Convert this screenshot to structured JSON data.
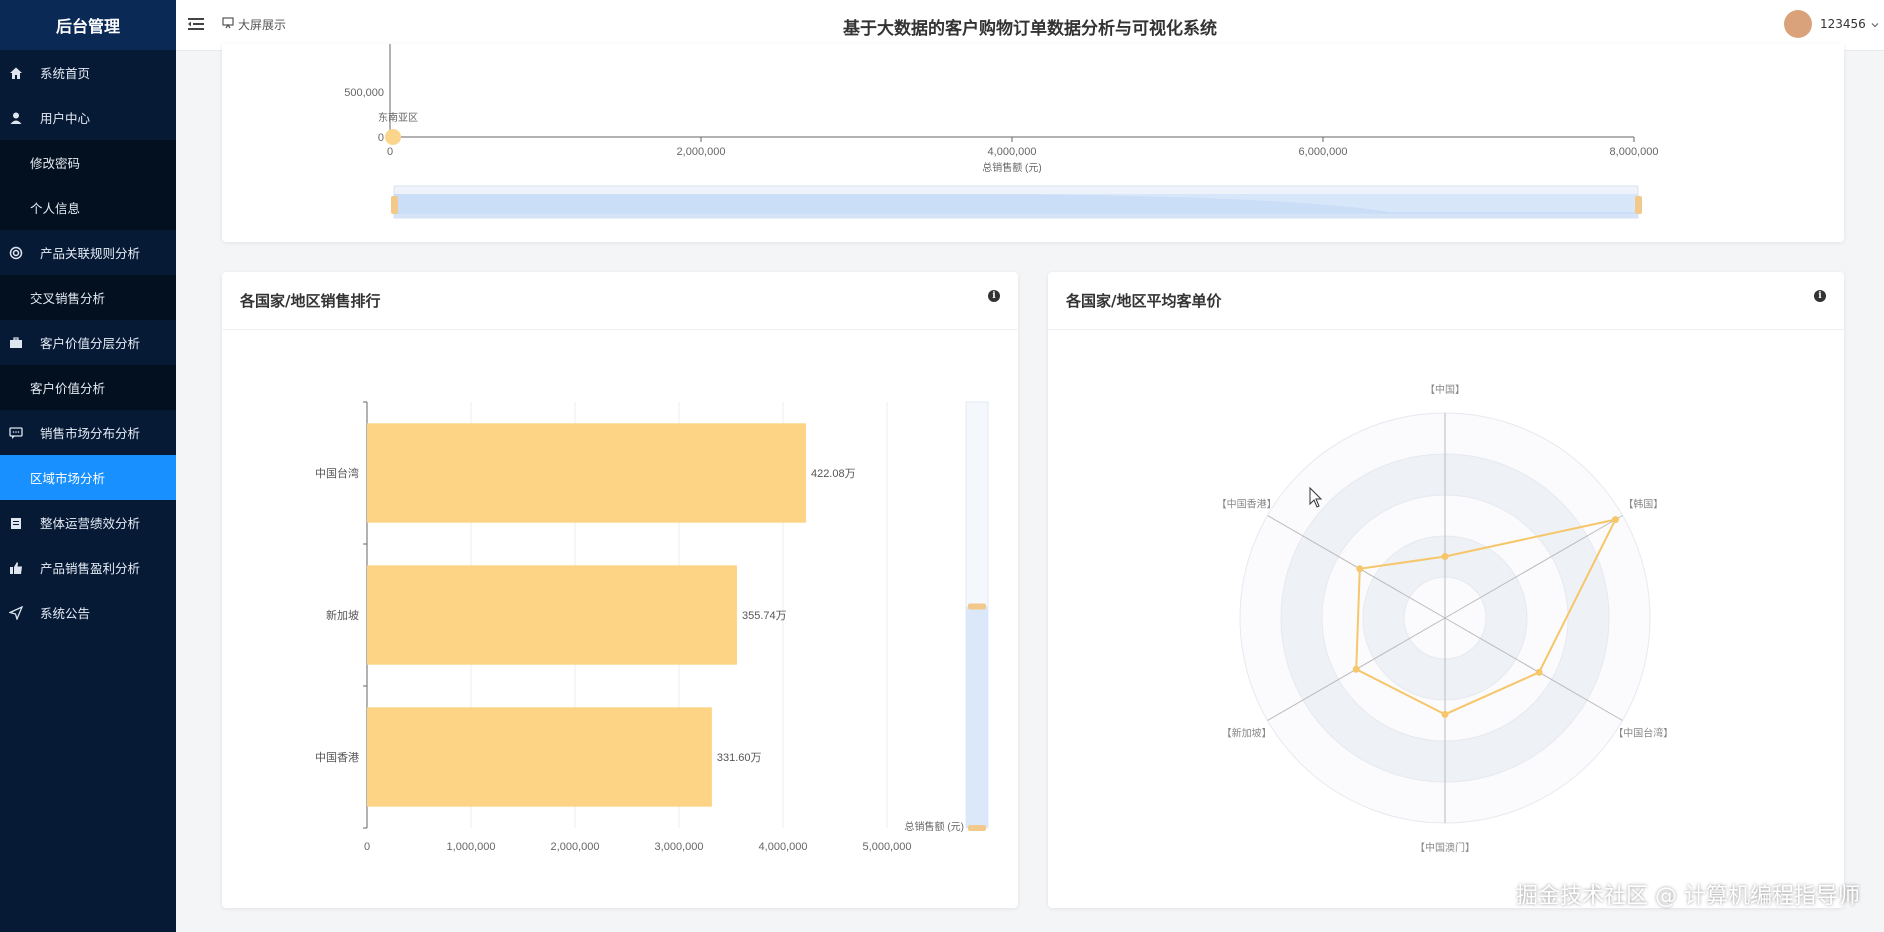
{
  "brand": "后台管理",
  "menu": [
    {
      "label": "系统首页",
      "icon": "home-icon",
      "type": "top"
    },
    {
      "label": "用户中心",
      "icon": "user-icon",
      "type": "top"
    },
    {
      "label": "修改密码",
      "type": "sub"
    },
    {
      "label": "个人信息",
      "type": "sub"
    },
    {
      "label": "产品关联规则分析",
      "icon": "circle-icon",
      "type": "top"
    },
    {
      "label": "交叉销售分析",
      "type": "sub"
    },
    {
      "label": "客户价值分层分析",
      "icon": "briefcase-icon",
      "type": "top"
    },
    {
      "label": "客户价值分析",
      "type": "sub"
    },
    {
      "label": "销售市场分布分析",
      "icon": "chat-icon",
      "type": "top"
    },
    {
      "label": "区域市场分析",
      "type": "sub",
      "active": true
    },
    {
      "label": "整体运营绩效分析",
      "icon": "clipboard-icon",
      "type": "top"
    },
    {
      "label": "产品销售盈利分析",
      "icon": "thumb-icon",
      "type": "top"
    },
    {
      "label": "系统公告",
      "icon": "send-icon",
      "type": "top"
    }
  ],
  "header": {
    "big_screen_label": "大屏展示",
    "title": "基于大数据的客户购物订单数据分析与可视化系统",
    "username": "123456"
  },
  "top_chart": {
    "y_ticks": [
      "500,000",
      "0"
    ],
    "x_ticks": [
      "0",
      "2,000,000",
      "4,000,000",
      "6,000,000",
      "8,000,000"
    ],
    "xlabel": "总销售额 (元)",
    "point_label": "东南亚区"
  },
  "bar_card": {
    "title": "各国家/地区销售排行"
  },
  "radar_card": {
    "title": "各国家/地区平均客单价"
  },
  "chart_data": [
    {
      "type": "bar",
      "orientation": "horizontal",
      "categories": [
        "中国台湾",
        "新加坡",
        "中国香港"
      ],
      "values": [
        4220800,
        3557400,
        3316000
      ],
      "data_labels": [
        "422.08万",
        "355.74万",
        "331.60万"
      ],
      "x_ticks": [
        "0",
        "1,000,000",
        "2,000,000",
        "3,000,000",
        "4,000,000",
        "5,000,000"
      ],
      "xlim": [
        0,
        5000000
      ],
      "xlabel": "总销售额 (元)",
      "color": "#fdd386",
      "data_zoom": {
        "start": 0.0,
        "end": 0.52
      }
    },
    {
      "type": "radar",
      "indicators": [
        "【中国】",
        "【韩国】",
        "【中国台湾】",
        "【中国澳门】",
        "【新加坡】",
        "【中国香港】"
      ],
      "values": [
        0.3,
        0.96,
        0.53,
        0.47,
        0.5,
        0.48
      ],
      "color": "#f6c66b"
    }
  ],
  "watermark": "掘金技术社区 @ 计算机编程指导师"
}
